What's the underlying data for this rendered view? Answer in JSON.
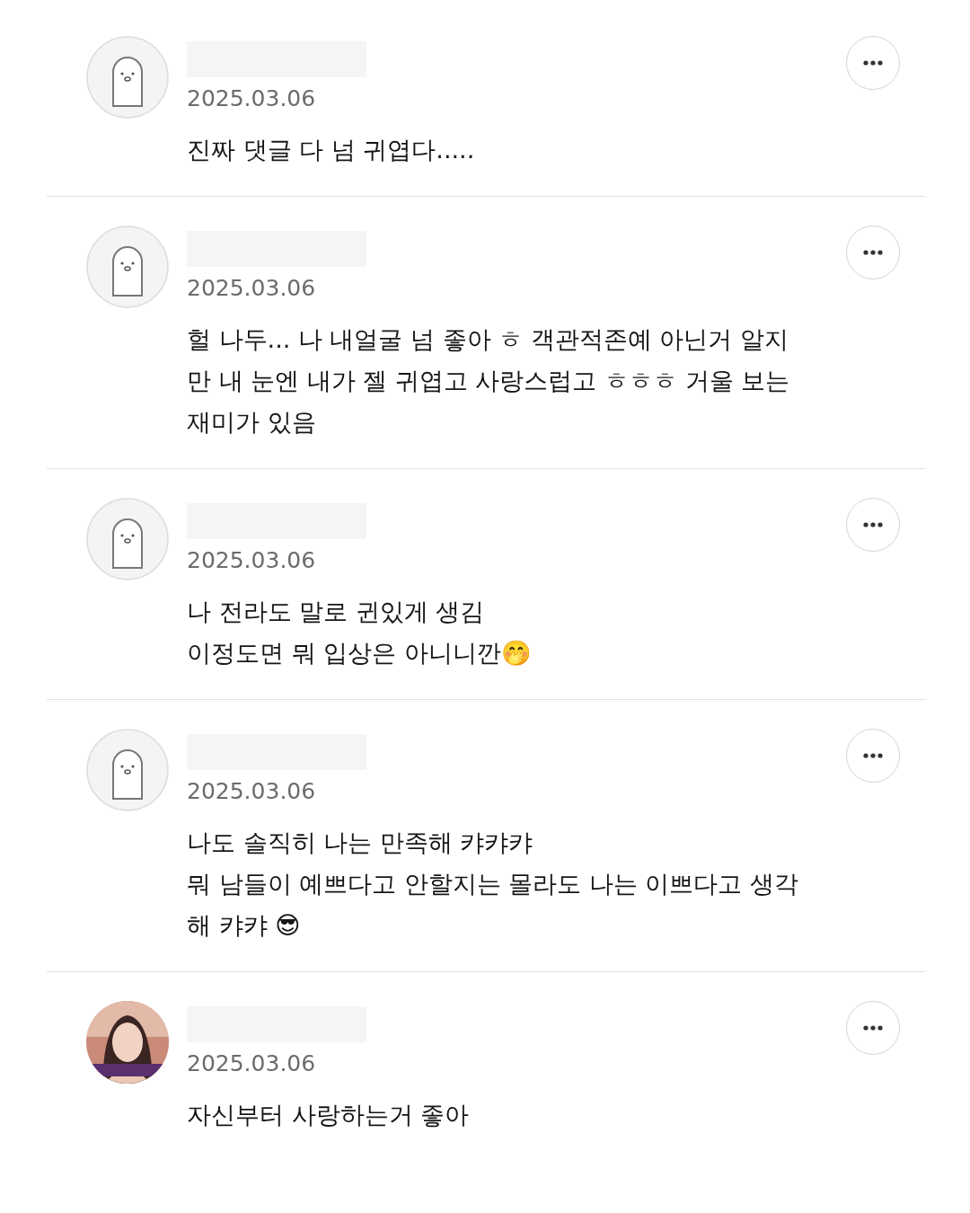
{
  "comments": [
    {
      "avatar": {
        "kind": "character"
      },
      "date": "2025.03.06",
      "text": "진짜 댓글 다 넘 귀엽다....."
    },
    {
      "avatar": {
        "kind": "character"
      },
      "date": "2025.03.06",
      "text": "헐 나두... 나 내얼굴 넘 좋아 ㅎ 객관적존예 아닌거 알지\n만 내 눈엔 내가 젤 귀엽고 사랑스럽고 ㅎㅎㅎ 거울 보는\n재미가 있음"
    },
    {
      "avatar": {
        "kind": "character"
      },
      "date": "2025.03.06",
      "text": "나 전라도 말로 귄있게 생김\n이정도면 뭐 입상은 아니니깐🤭"
    },
    {
      "avatar": {
        "kind": "character"
      },
      "date": "2025.03.06",
      "text": "나도 솔직히 나는 만족해 캬캬캬\n뭐 남들이 예쁘다고 안할지는 몰라도 나는 이쁘다고 생각\n해 캬캬 😎"
    },
    {
      "date": "2025.03.06",
      "text": "자신부터 사랑하는거 좋아"
    }
  ]
}
